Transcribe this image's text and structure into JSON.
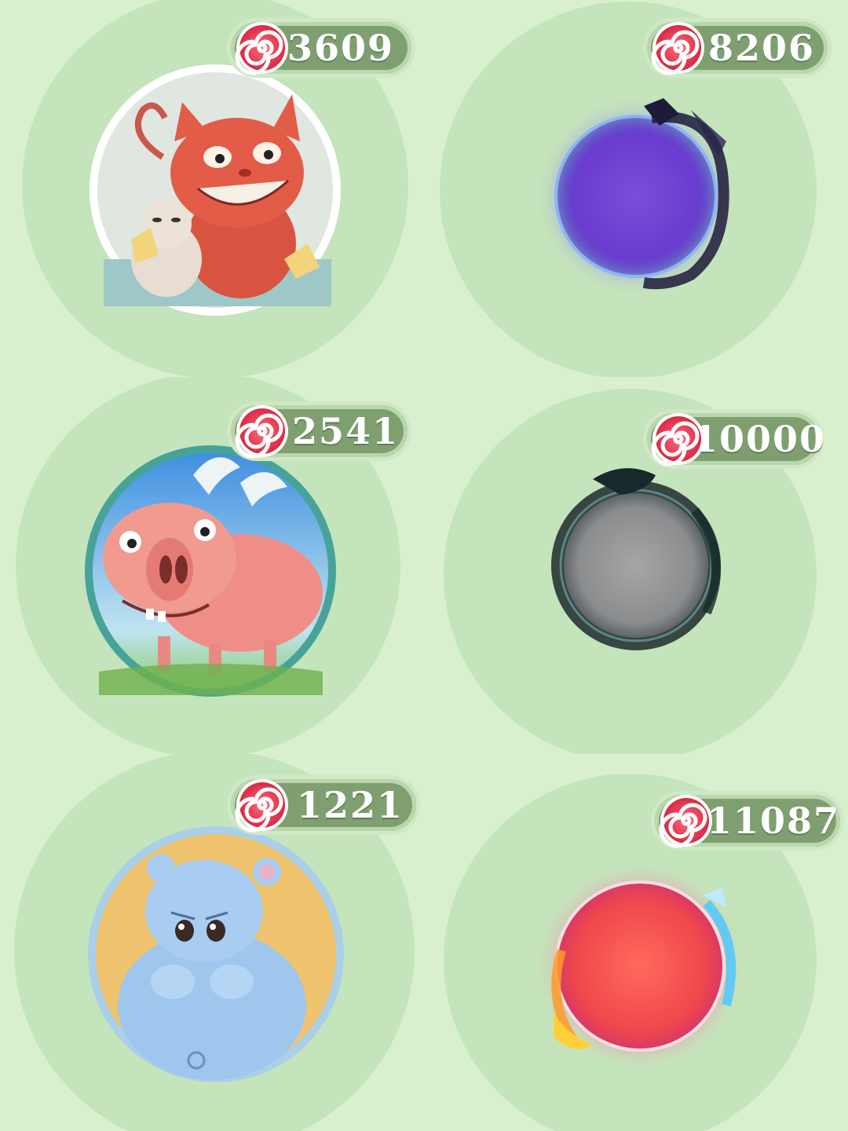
{
  "items": [
    {
      "name": "cat",
      "price": "3609",
      "frame": "white"
    },
    {
      "name": "dark-dragon-purple-orb",
      "price": "8206"
    },
    {
      "name": "pig",
      "price": "2541",
      "frame": "teal"
    },
    {
      "name": "dark-dragon-grey-orb",
      "price": "10000"
    },
    {
      "name": "hippo",
      "price": "1221",
      "frame": "light-blue"
    },
    {
      "name": "fire-ice-red-orb",
      "price": "11087"
    }
  ],
  "currency_icon": "swirl-candy-icon",
  "colors": {
    "background": "#d9f0cf",
    "circle": "#c4e4bb",
    "badge": "#7f9f71",
    "candy": "#e8384f"
  }
}
